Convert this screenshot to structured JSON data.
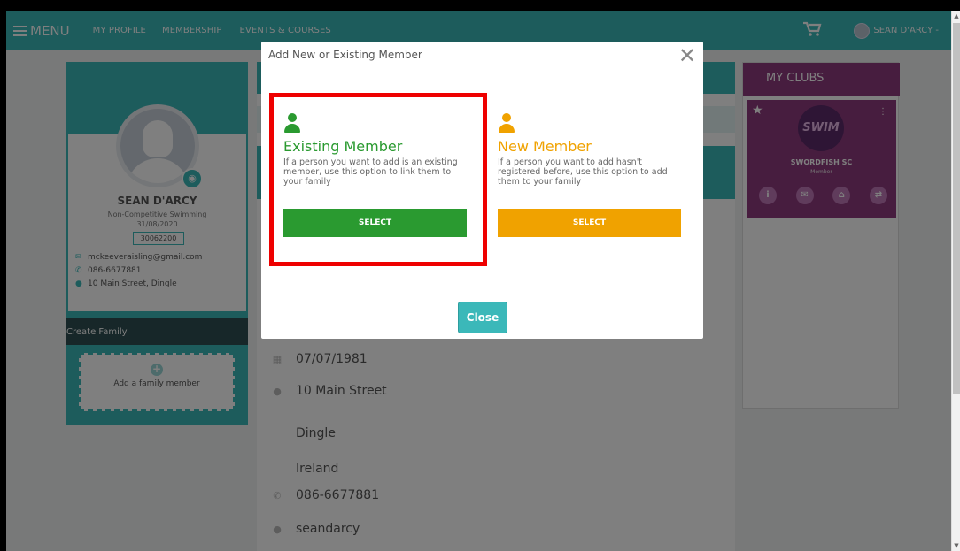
{
  "nav": {
    "menu_label": "MENU",
    "links": [
      "MY PROFILE",
      "MEMBERSHIP",
      "EVENTS & COURSES"
    ],
    "user_label": "SEAN D'ARCY -"
  },
  "profile": {
    "name": "SEAN D'ARCY",
    "membership_type": "Non-Competitive Swimming",
    "date": "31/08/2020",
    "member_id": "30062200",
    "email": "mckeeveraisling@gmail.com",
    "phone": "086-6677881",
    "address": "10 Main Street, Dingle",
    "create_family_label": "Create Family",
    "add_family_label": "Add a family member"
  },
  "details": {
    "dob": "07/07/1981",
    "street": "10 Main Street",
    "town": "Dingle",
    "country": "Ireland",
    "phone": "086-6677881",
    "username": "seandarcy"
  },
  "clubs": {
    "heading": "MY CLUBS",
    "club_name": "SWORDFISH SC",
    "club_role": "Member",
    "logo_text": "SWIM"
  },
  "modal": {
    "title": "Add New or Existing Member",
    "existing": {
      "title": "Existing Member",
      "description": "If a person you want to add is an existing member, use this option to link them to your family",
      "button": "SELECT"
    },
    "new": {
      "title": "New Member",
      "description": "If a person you want to add hasn't registered before, use this option to add them to your family",
      "button": "SELECT"
    },
    "close_label": "Close"
  },
  "colors": {
    "teal": "#3bb8b9",
    "green": "#2a9a30",
    "orange": "#f0a200",
    "purple": "#8f3a7e",
    "highlight_red": "#ee0000"
  }
}
